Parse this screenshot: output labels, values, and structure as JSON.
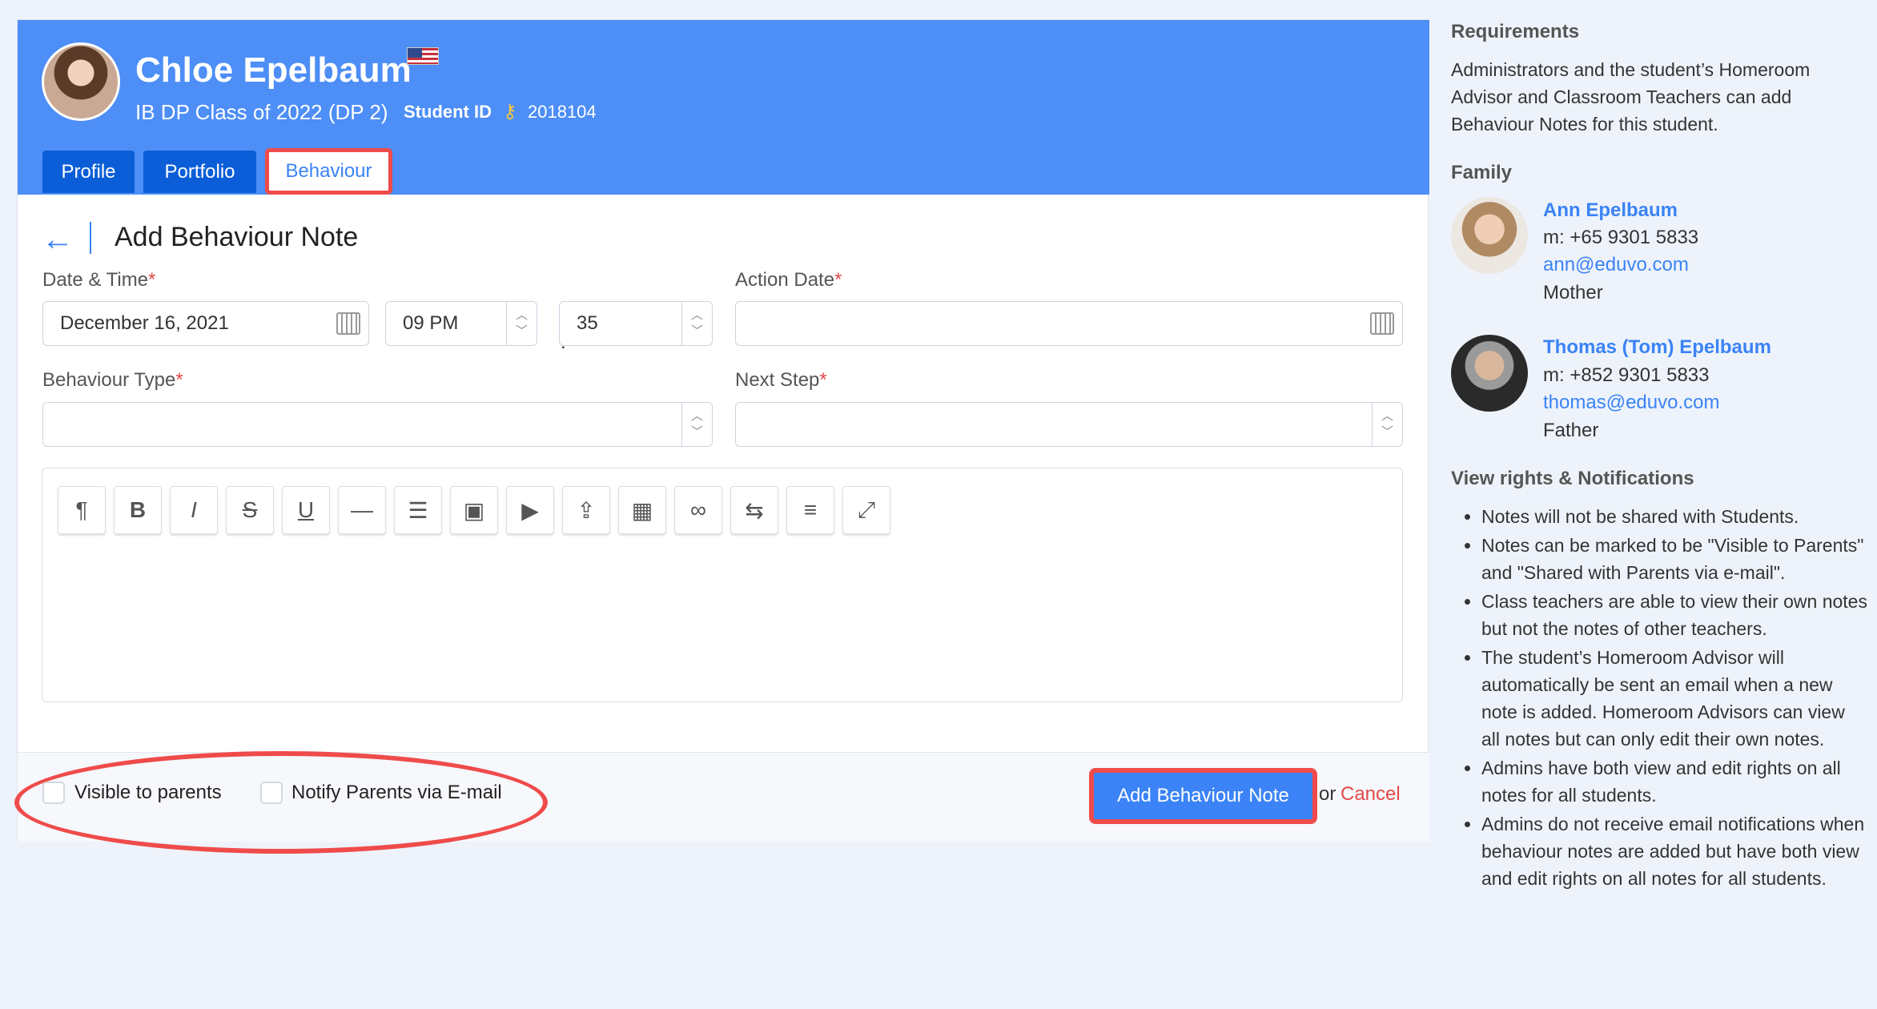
{
  "student": {
    "name": "Chloe Epelbaum",
    "class": "IB DP Class of 2022 (DP 2)",
    "id_label": "Student ID",
    "id_value": "2018104"
  },
  "tabs": [
    "Profile",
    "Portfolio",
    "Behaviour"
  ],
  "active_tab": "Behaviour",
  "page_title": "Add Behaviour Note",
  "form": {
    "datetime_label": "Date & Time",
    "date_value": "December 16, 2021",
    "hour_value": "09 PM",
    "minute_value": "35",
    "action_date_label": "Action Date",
    "behaviour_type_label": "Behaviour Type",
    "next_step_label": "Next Step",
    "required_mark": "*"
  },
  "toolbar_icons": [
    "paragraph-icon",
    "bold-icon",
    "italic-icon",
    "strikethrough-icon",
    "underline-icon",
    "horizontal-rule-icon",
    "list-icon",
    "image-icon",
    "video-icon",
    "upload-icon",
    "table-icon",
    "link-icon",
    "swap-icon",
    "align-icon",
    "fullscreen-icon"
  ],
  "footer": {
    "visible_label": "Visible to parents",
    "notify_label": "Notify Parents via E-mail",
    "submit_label": "Add Behaviour Note",
    "or_text": "or",
    "cancel_label": "Cancel"
  },
  "sidebar": {
    "requirements_title": "Requirements",
    "requirements_text": "Administrators and the student’s Homeroom Advisor and Classroom Teachers can add Behaviour Notes for this student.",
    "family_title": "Family",
    "family": [
      {
        "name": "Ann Epelbaum",
        "phone": "m: +65 9301 5833",
        "email": "ann@eduvo.com",
        "relation": "Mother"
      },
      {
        "name": "Thomas (Tom) Epelbaum",
        "phone": "m: +852 9301 5833",
        "email": "thomas@eduvo.com",
        "relation": "Father"
      }
    ],
    "rights_title": "View rights & Notifications",
    "notes": [
      "Notes will not be shared with Students.",
      "Notes can be marked to be \"Visible to Parents\" and \"Shared with Parents via e-mail\".",
      "Class teachers are able to view their own notes but not the notes of other teachers.",
      "The student’s Homeroom Advisor will automatically be sent an email when a new note is added. Homeroom Advisors can view all notes but can only edit their own notes.",
      "Admins have both view and edit rights on all notes for all students.",
      "Admins do not receive email notifications when behaviour notes are added but have both view and edit rights on all notes for all students."
    ]
  }
}
